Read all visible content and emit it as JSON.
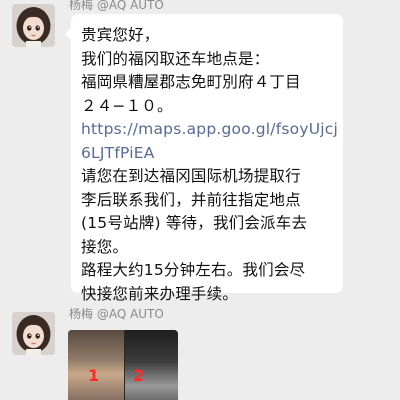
{
  "messages": [
    {
      "sender": "杨梅 @AQ AUTO",
      "avatar": "girl-avatar",
      "type": "text",
      "lines": [
        "贵宾您好，",
        "我们的福冈取还车地点是：",
        "福岡県糟屋郡志免町別府４丁目",
        "２４−１０。",
        "https://maps.app.goo.gl/fsoyUjcj",
        "6LJTfPiEA",
        "请您在到达福冈国际机场提取行",
        "李后联系我们，并前往指定地点",
        "(15号站牌) 等待，我们会派车去",
        "接您。",
        "路程大约15分钟左右。我们会尽",
        "快接您前来办理手续。"
      ]
    },
    {
      "sender": "杨梅 @AQ AUTO",
      "avatar": "girl-avatar",
      "type": "image",
      "photo_labels": [
        "1",
        "2"
      ]
    }
  ],
  "colors": {
    "background": "#ededed",
    "bubble": "#ffffff",
    "link": "#576b95",
    "sender": "#8a8a8a",
    "photo_number": "#ff2a2a"
  }
}
